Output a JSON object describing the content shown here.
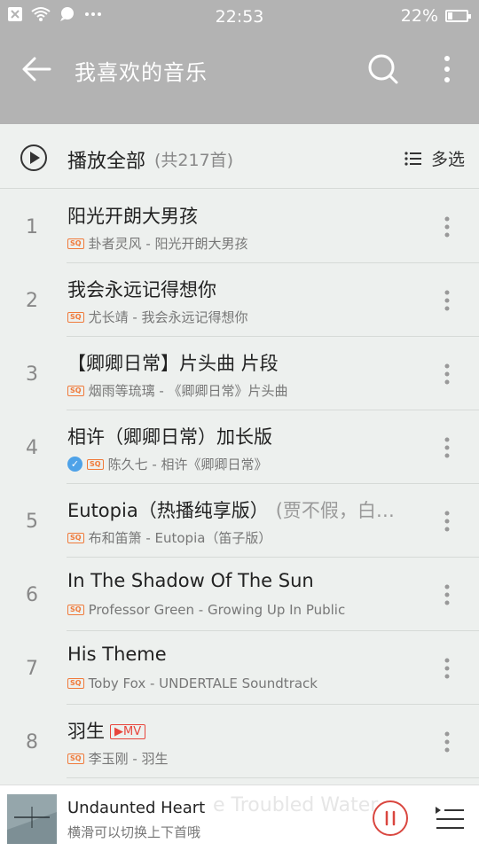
{
  "status_bar": {
    "time": "22:53",
    "battery": "22%",
    "icons": [
      "notification-x-icon",
      "wifi-icon",
      "chat-icon",
      "more-dots-icon"
    ]
  },
  "header": {
    "title": "我喜欢的音乐",
    "back_icon": "arrow-left-icon",
    "search_icon": "search-icon",
    "more_icon": "vertical-dots-icon"
  },
  "play_all": {
    "label": "播放全部",
    "count": "(共217首)",
    "multi_select": "多选"
  },
  "songs": [
    {
      "num": "1",
      "title": "阳光开朗大男孩",
      "extra": "",
      "badge": "SQ",
      "meta": "卦者灵风 - 阳光开朗大男孩",
      "verified": false,
      "mv": ""
    },
    {
      "num": "2",
      "title": "我会永远记得想你",
      "extra": "",
      "badge": "SQ",
      "meta": "尤长靖 - 我会永远记得想你",
      "verified": false,
      "mv": ""
    },
    {
      "num": "3",
      "title": "【卿卿日常】片头曲 片段",
      "extra": "",
      "badge": "SQ",
      "meta": "烟雨等琉璃 - 《卿卿日常》片头曲",
      "verified": false,
      "mv": ""
    },
    {
      "num": "4",
      "title": "相许（卿卿日常）加长版",
      "extra": "",
      "badge": "SQ",
      "meta": "陈久七 - 相许《卿卿日常》",
      "verified": true,
      "mv": ""
    },
    {
      "num": "5",
      "title": "Eutopia（热播纯享版）",
      "extra": "(贾不假，白…",
      "badge": "SQ",
      "meta": "布和笛箫 - Eutopia（笛子版）",
      "verified": false,
      "mv": ""
    },
    {
      "num": "6",
      "title": "In The Shadow Of The Sun",
      "extra": "",
      "badge": "SQ",
      "meta": "Professor Green - Growing Up In Public",
      "verified": false,
      "mv": ""
    },
    {
      "num": "7",
      "title": "His Theme",
      "extra": "",
      "badge": "SQ",
      "meta": "Toby Fox - UNDERTALE Soundtrack",
      "verified": false,
      "mv": ""
    },
    {
      "num": "8",
      "title": "羽生",
      "extra": "",
      "badge": "SQ",
      "meta": "李玉刚 - 羽生",
      "verified": false,
      "mv": "▶MV"
    }
  ],
  "mini_player": {
    "song": "Undaunted Heart",
    "hint": "横滑可以切换上下首哦",
    "ghost_text": "e Troubled Water"
  },
  "colors": {
    "header_bg": "#b3b3b3",
    "sq_badge": "#f07a3a",
    "mv_badge": "#e8453c",
    "pause_ring": "#d9463f",
    "verified": "#4ea2e8"
  }
}
